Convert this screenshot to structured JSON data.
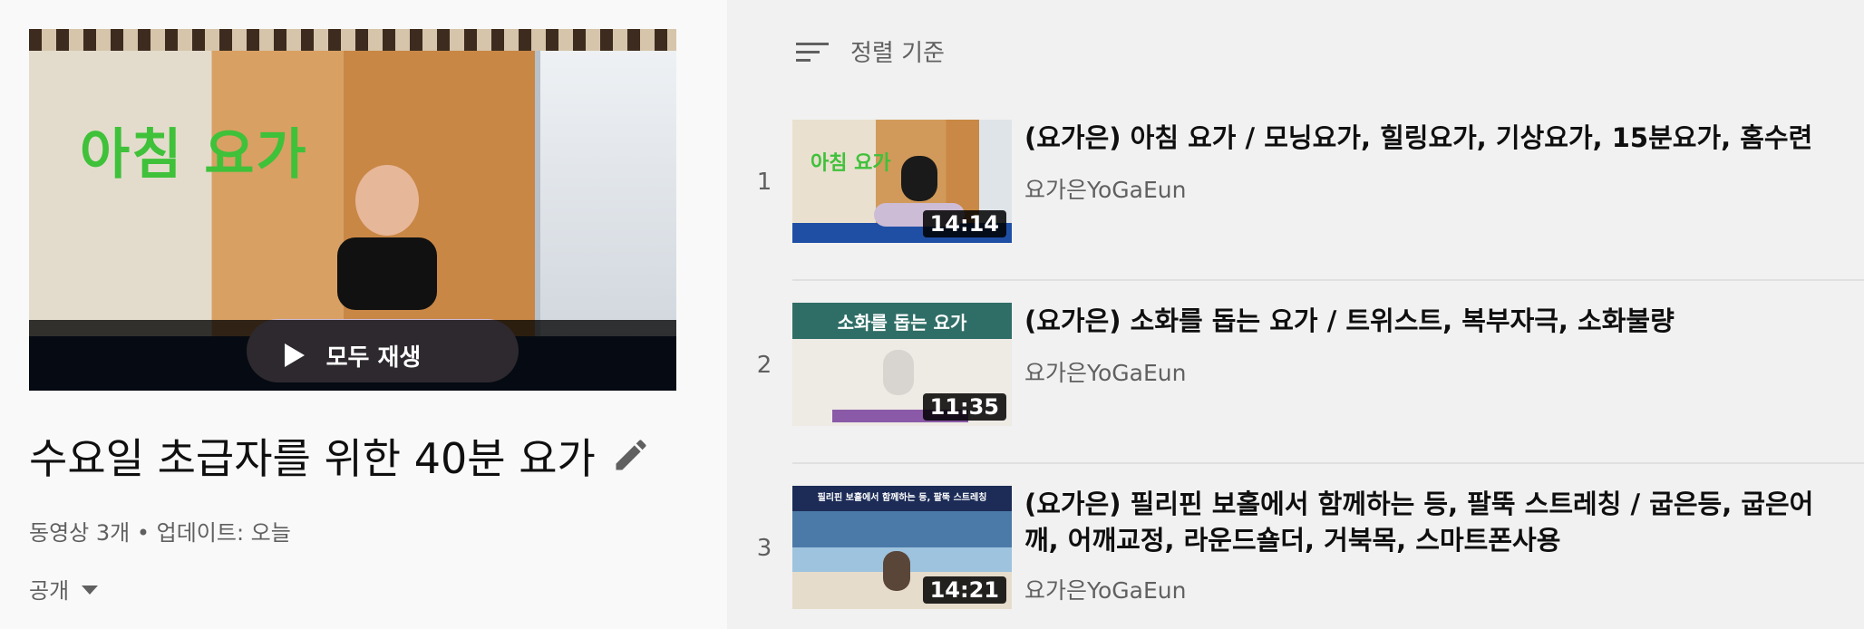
{
  "playlist": {
    "hero_text": "아침 요가",
    "play_all_label": "모두 재생",
    "title": "수요일 초급자를 위한 40분 요가",
    "meta": "동영상 3개 • 업데이트: 오늘",
    "privacy": "공개"
  },
  "sort": {
    "label": "정렬 기준"
  },
  "videos": [
    {
      "index": "1",
      "title": "(요가은) 아침 요가 / 모닝요가, 힐링요가, 기상요가, 15분요가, 홈수련",
      "channel": "요가은YoGaEun",
      "duration": "14:14",
      "thumb_text": "아침 요가"
    },
    {
      "index": "2",
      "title": "(요가은) 소화를 돕는 요가 / 트위스트, 복부자극, 소화불량",
      "channel": "요가은YoGaEun",
      "duration": "11:35",
      "thumb_text": "소화를 돕는 요가"
    },
    {
      "index": "3",
      "title": "(요가은) 필리핀 보홀에서 함께하는 등, 팔뚝 스트레칭 / 굽은등, 굽은어깨, 어깨교정, 라운드숄더, 거북목, 스마트폰사용",
      "channel": "요가은YoGaEun",
      "duration": "14:21",
      "thumb_text": "필리핀 보홀에서 함께하는 등, 팔뚝 스트레칭"
    }
  ],
  "colors": {
    "left_bg": "#f9f9f9",
    "right_bg": "#f1f1f1",
    "text_primary": "#0f0f0f",
    "text_secondary": "#606060",
    "hero_text": "#3fc13a"
  },
  "icons": {
    "play": "play-icon",
    "edit": "pencil-icon",
    "sort": "sort-icon",
    "caret": "caret-down-icon"
  }
}
